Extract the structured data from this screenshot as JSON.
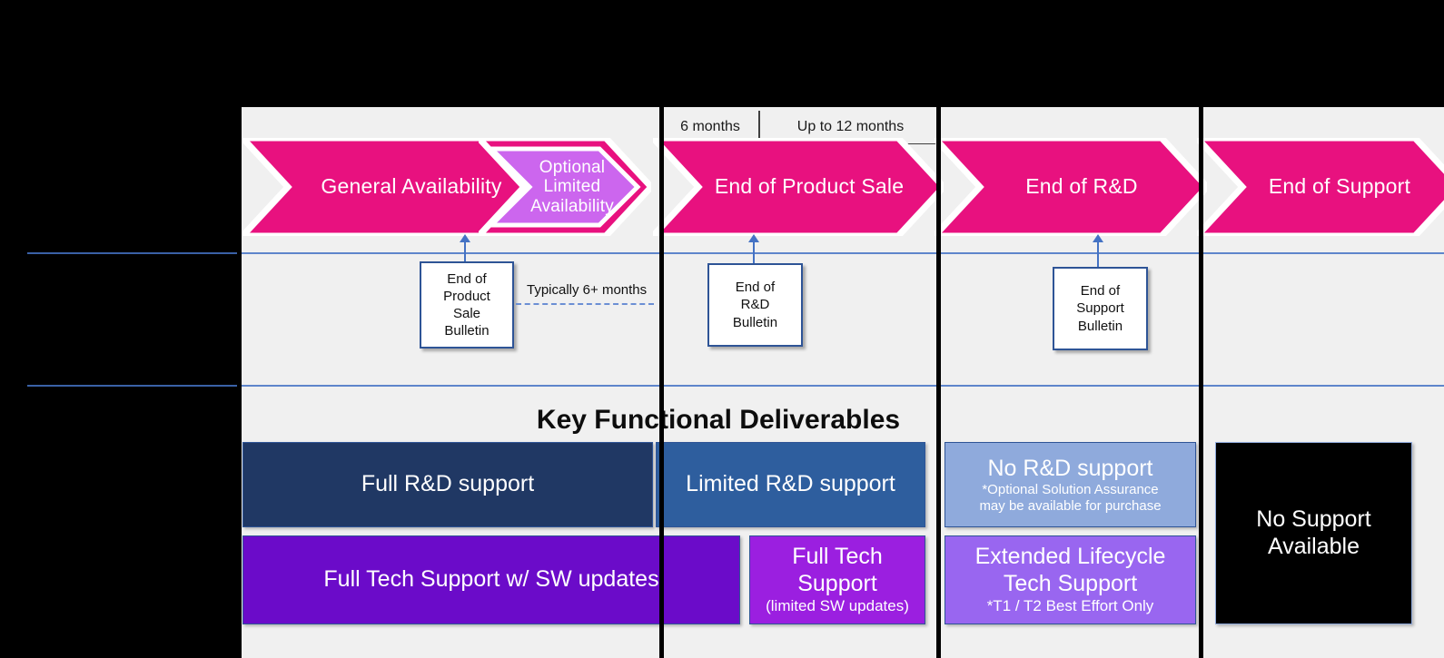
{
  "colors": {
    "pink": "#E8117F",
    "light_purple": "#CC66EE",
    "panel_bg": "#F0F0F0",
    "rule_blue": "#4472C4",
    "navy": "#203864",
    "mid_blue": "#2E5E9E",
    "pale_blue": "#8FAADC",
    "deep_purple": "#6B0BC9",
    "bright_purple": "#9B1FE0",
    "soft_purple": "#9966F0",
    "black": "#000000"
  },
  "header": {
    "months": [
      {
        "label": "6 months"
      },
      {
        "label": "Up to 12 months"
      }
    ]
  },
  "phases": [
    {
      "label": "General Availability",
      "tone": "pink"
    },
    {
      "label": "Optional\nLimited\nAvailability",
      "tone": "light_purple"
    },
    {
      "label": "End of Product Sale",
      "tone": "pink"
    },
    {
      "label": "End of R&D",
      "tone": "pink"
    },
    {
      "label": "End of Support",
      "tone": "pink"
    }
  ],
  "bulletins": [
    {
      "label": "End of\nProduct\nSale\nBulletin"
    },
    {
      "label": "End of\nR&D\nBulletin"
    },
    {
      "label": "End of\nSupport\nBulletin"
    }
  ],
  "interval": {
    "label": "Typically 6+ months"
  },
  "deliverables": {
    "heading": "Key Functional Deliverables",
    "rd_row": [
      {
        "title": "Full R&D support",
        "note": "",
        "note2": "",
        "tone": "navy"
      },
      {
        "title": "Limited R&D support",
        "note": "",
        "note2": "",
        "tone": "mid_blue"
      },
      {
        "title": "No R&D support",
        "note": "*Optional Solution Assurance",
        "note2": "may be available for purchase",
        "tone": "pale_blue"
      }
    ],
    "tech_row": [
      {
        "title": "Full Tech Support w/ SW updates",
        "note": "",
        "tone": "deep_purple"
      },
      {
        "title": "Full Tech\nSupport",
        "note": "(limited SW updates)",
        "tone": "bright_purple"
      },
      {
        "title": "Extended Lifecycle\nTech Support",
        "note": "*T1 / T2 Best Effort Only",
        "tone": "soft_purple"
      }
    ],
    "no_support": {
      "title": "No Support\nAvailable",
      "tone": "black"
    }
  }
}
